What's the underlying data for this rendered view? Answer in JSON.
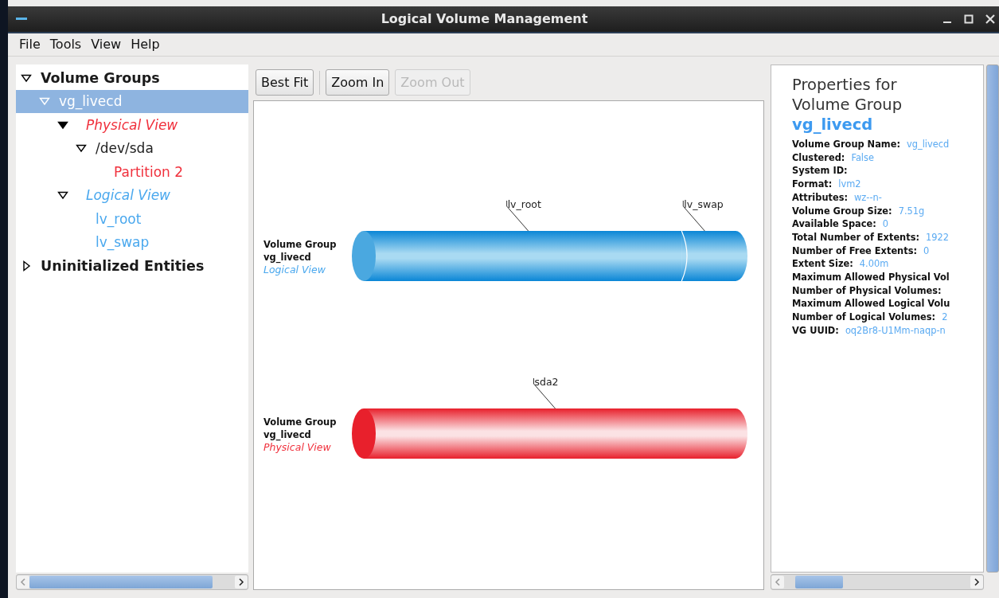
{
  "window": {
    "title": "Logical Volume Management"
  },
  "menu": [
    "File",
    "Tools",
    "View",
    "Help"
  ],
  "tree": [
    {
      "label": "Volume Groups",
      "kind": "header",
      "expanded": true,
      "selected": false,
      "children": [
        {
          "label": "vg_livecd",
          "kind": "node",
          "expanded": true,
          "selected": true,
          "children": [
            {
              "label": "Physical View",
              "kind": "view",
              "color": "#f0303c",
              "expanded": true,
              "selected": false,
              "children": [
                {
                  "label": "/dev/sda",
                  "kind": "node",
                  "expanded": true,
                  "selected": false,
                  "children": [
                    {
                      "label": "Partition 2",
                      "kind": "node",
                      "color": "#f0303c",
                      "selected": false
                    }
                  ]
                }
              ]
            },
            {
              "label": "Logical View",
              "kind": "view",
              "color": "#4aa8ee",
              "expanded": true,
              "selected": false,
              "children": [
                {
                  "label": "lv_root",
                  "kind": "node",
                  "color": "#4aa8ee",
                  "selected": false
                },
                {
                  "label": "lv_swap",
                  "kind": "node",
                  "color": "#4aa8ee",
                  "selected": false
                }
              ]
            }
          ]
        }
      ]
    },
    {
      "label": "Uninitialized Entities",
      "kind": "header",
      "expanded": false,
      "selected": false
    }
  ],
  "toolbar": [
    {
      "label": "Best Fit",
      "disabled": false
    },
    {
      "label": "Zoom In",
      "disabled": false
    },
    {
      "label": "Zoom Out",
      "disabled": true
    }
  ],
  "canvas": {
    "volumes": [
      {
        "kind": "logical",
        "heading": [
          "Volume Group",
          "vg_livecd"
        ],
        "view": "Logical View",
        "segments": [
          {
            "label": "lv_root"
          },
          {
            "label": "lv_swap"
          }
        ]
      },
      {
        "kind": "physical",
        "heading": [
          "Volume Group",
          "vg_livecd"
        ],
        "view": "Physical View",
        "segments": [
          {
            "label": "sda2"
          }
        ]
      }
    ]
  },
  "properties": {
    "title_lines": [
      "Properties for",
      "Volume Group"
    ],
    "name": "vg_livecd",
    "rows": [
      {
        "label": "Volume Group Name:",
        "value": "vg_livecd"
      },
      {
        "label": "Clustered:",
        "value": "False"
      },
      {
        "label": "System ID:"
      },
      {
        "label": "Format:",
        "value": "lvm2"
      },
      {
        "label": "Attributes:",
        "value": "wz--n-"
      },
      {
        "label": "Volume Group Size:",
        "value": "7.51g"
      },
      {
        "label": "Available Space:",
        "value": "0"
      },
      {
        "label": "Total Number of Extents:",
        "value": "1922"
      },
      {
        "label": "Number of Free Extents:",
        "value": "0"
      },
      {
        "label": "Extent Size:",
        "value": "4.00m"
      },
      {
        "label": "Maximum Allowed Physical Vol"
      },
      {
        "label": "Number of Physical Volumes:"
      },
      {
        "label": "Maximum Allowed Logical Volu"
      },
      {
        "label": "Number of Logical Volumes:",
        "value": "2"
      },
      {
        "label": "VG UUID:",
        "value": "oq2Br8-U1Mm-naqp-n"
      }
    ]
  }
}
